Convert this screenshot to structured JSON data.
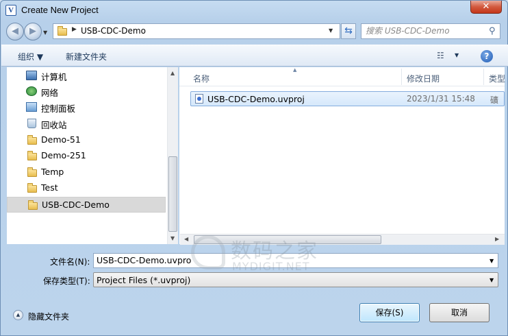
{
  "window": {
    "title": "Create New Project",
    "app_icon_glyph": "V",
    "close_glyph": "✕"
  },
  "navigation": {
    "back_glyph": "◀",
    "forward_glyph": "▶",
    "path_separator_glyph": "▶",
    "path": "USB-CDC-Demo",
    "search_placeholder": "搜索 USB-CDC-Demo"
  },
  "toolbar": {
    "organize_label": "组织 ▼",
    "new_folder_label": "新建文件夹",
    "view_glyph": "☷",
    "help_glyph": "?"
  },
  "sidebar": {
    "items": [
      {
        "label": "计算机",
        "icon": "computer-icon"
      },
      {
        "label": "网络",
        "icon": "network-icon"
      },
      {
        "label": "控制面板",
        "icon": "control-panel-icon"
      },
      {
        "label": "回收站",
        "icon": "recycle-bin-icon"
      },
      {
        "label": "Demo-51",
        "icon": "folder-icon"
      },
      {
        "label": "Demo-251",
        "icon": "folder-icon"
      },
      {
        "label": "Temp",
        "icon": "folder-icon"
      },
      {
        "label": "Test",
        "icon": "folder-icon"
      },
      {
        "label": "USB-CDC-Demo",
        "icon": "folder-icon",
        "selected": true
      }
    ]
  },
  "file_list": {
    "columns": [
      "名称",
      "修改日期",
      "类型"
    ],
    "rows": [
      {
        "name": "USB-CDC-Demo.uvproj",
        "modified": "2023/1/31 15:48",
        "type": "礦"
      }
    ]
  },
  "form": {
    "filename_label": "文件名(N):",
    "filename_value": "USB-CDC-Demo.uvproj",
    "filetype_label": "保存类型(T):",
    "filetype_value": "Project Files (*.uvproj)"
  },
  "footer": {
    "hide_folders_label": "隐藏文件夹",
    "save_label": "保存(S)",
    "cancel_label": "取消"
  },
  "watermark": {
    "text_cn": "数码之家",
    "text_en": "MYDIGIT.NET"
  },
  "colors": {
    "frame": "#bcd4ec",
    "selection": "#d6e8fb",
    "close_button": "#d25a3e"
  }
}
